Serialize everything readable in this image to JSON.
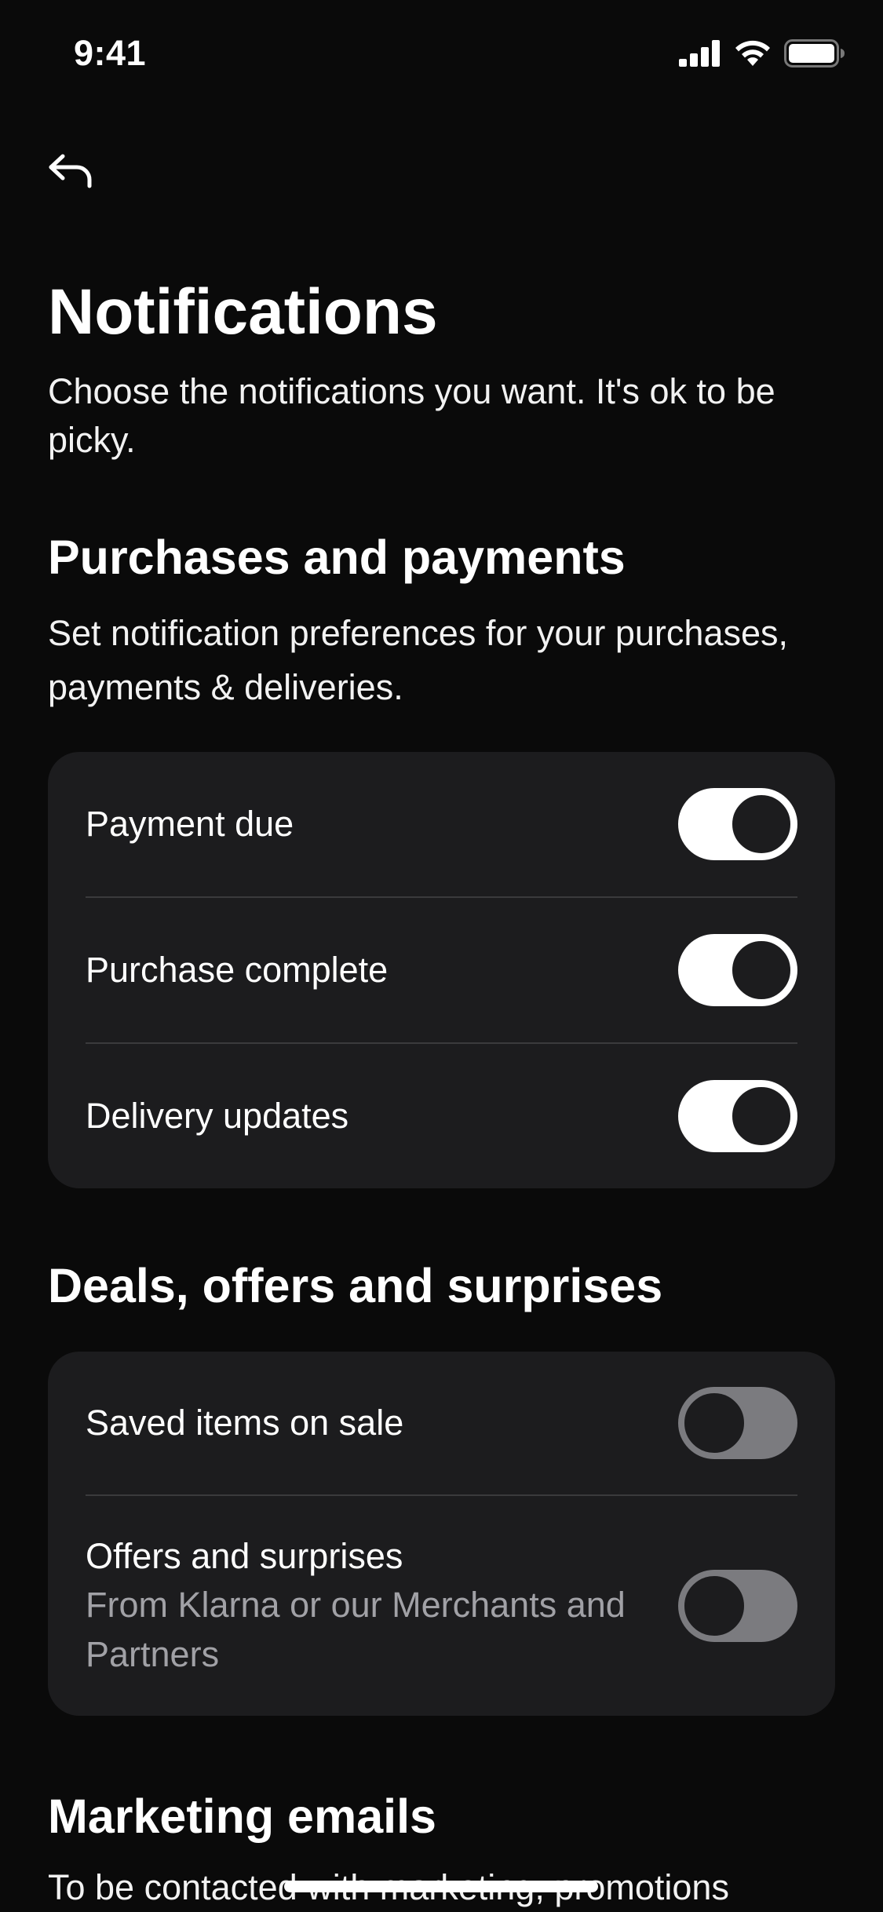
{
  "status_bar": {
    "time": "9:41",
    "icons": [
      "cellular-signal-icon",
      "wifi-icon",
      "battery-icon"
    ]
  },
  "nav": {
    "back_icon": "back-arrow-icon"
  },
  "page": {
    "title": "Notifications",
    "subtitle": "Choose the notifications you want. It's ok to be picky."
  },
  "sections": {
    "purchases": {
      "title": "Purchases and payments",
      "description": "Set notification preferences for your purchases, payments & deliveries.",
      "items": [
        {
          "label": "Payment due",
          "enabled": true
        },
        {
          "label": "Purchase complete",
          "enabled": true
        },
        {
          "label": "Delivery updates",
          "enabled": true
        }
      ]
    },
    "deals": {
      "title": "Deals, offers and surprises",
      "items": [
        {
          "label": "Saved items on sale",
          "enabled": false
        },
        {
          "label": "Offers and surprises",
          "sublabel": "From Klarna or our Merchants and Partners",
          "enabled": false
        }
      ]
    },
    "marketing": {
      "title": "Marketing emails",
      "description": "To be contacted with marketing, promotions"
    }
  },
  "colors": {
    "background": "#0a0a0a",
    "card": "#1c1c1e",
    "divider": "#3a3a3c",
    "toggle_on": "#ffffff",
    "toggle_off": "#7b7b7f",
    "secondary_text": "#a1a1a6"
  }
}
